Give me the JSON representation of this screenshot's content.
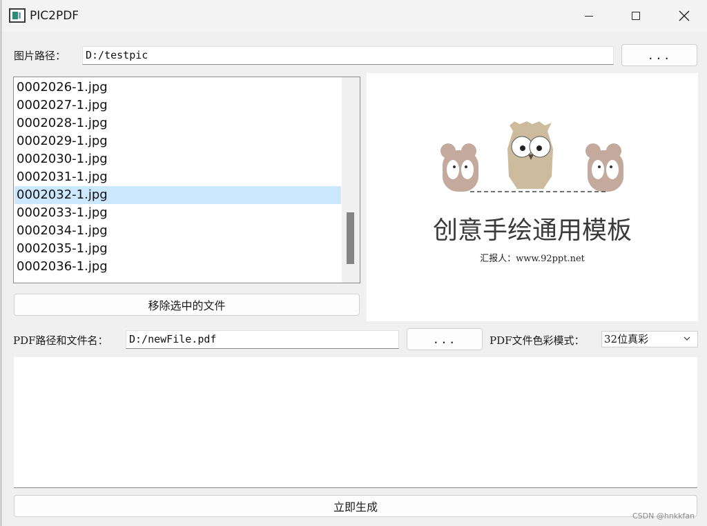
{
  "window": {
    "title": "PIC2PDF"
  },
  "image_path": {
    "label": "图片路径：",
    "value": "D:/testpic",
    "browse_label": "..."
  },
  "file_list": {
    "items": [
      "0002026-1.jpg",
      "0002027-1.jpg",
      "0002028-1.jpg",
      "0002029-1.jpg",
      "0002030-1.jpg",
      "0002031-1.jpg",
      "0002032-1.jpg",
      "0002033-1.jpg",
      "0002034-1.jpg",
      "0002035-1.jpg",
      "0002036-1.jpg"
    ],
    "selected": "0002032-1.jpg",
    "remove_label": "移除选中的文件"
  },
  "preview": {
    "slide_title": "创意手绘通用模板",
    "slide_subtitle": "汇报人：www.92ppt.net"
  },
  "pdf": {
    "path_label": "PDF路径和文件名：",
    "path_value": "D:/newFile.pdf",
    "browse_label": "...",
    "mode_label": "PDF文件色彩模式：",
    "mode_value": "32位真彩"
  },
  "generate_label": "立即生成",
  "watermark": "CSDN @hnkkfan",
  "colors": {
    "selection": "#cce8ff",
    "background": "#f0f0f0"
  }
}
